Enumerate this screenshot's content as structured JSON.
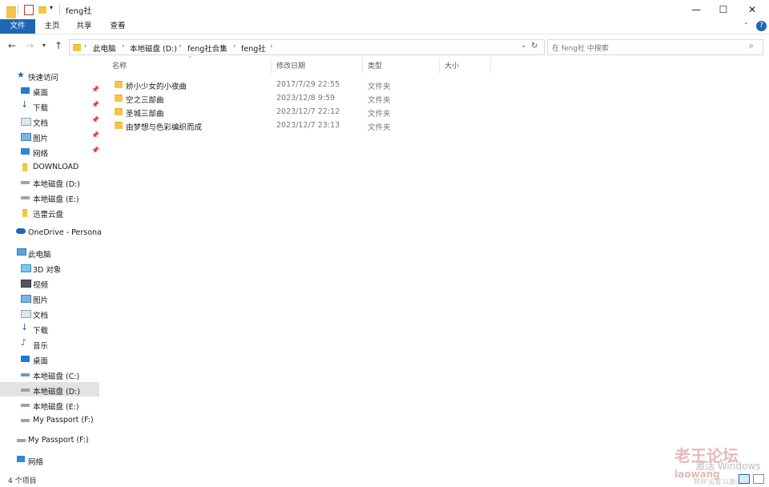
{
  "window": {
    "title": "feng社",
    "controls": {
      "minimize": "—",
      "maximize": "☐",
      "close": "✕"
    }
  },
  "ribbon": {
    "tabs": [
      "文件",
      "主页",
      "共享",
      "查看"
    ],
    "help_icon": "?"
  },
  "address": {
    "crumbs": [
      "此电脑",
      "本地磁盘 (D:)",
      "feng社合集",
      "feng社"
    ]
  },
  "search": {
    "placeholder": "在 feng社 中搜索"
  },
  "columns": {
    "name": "名称",
    "date": "修改日期",
    "type": "类型",
    "size": "大小"
  },
  "files": [
    {
      "name": "娇小少女的小夜曲",
      "date": "2017/7/29 22:55",
      "type": "文件夹"
    },
    {
      "name": "空之三部曲",
      "date": "2023/12/8 9:59",
      "type": "文件夹"
    },
    {
      "name": "圣城三部曲",
      "date": "2023/12/7 22:12",
      "type": "文件夹"
    },
    {
      "name": "由梦想与色彩编织而成",
      "date": "2023/12/7 23:13",
      "type": "文件夹"
    }
  ],
  "nav": {
    "quick_access": "快速访问",
    "quick_items": [
      "桌面",
      "下载",
      "文档",
      "图片",
      "网络",
      "DOWNLOAD",
      "本地磁盘 (D:)",
      "本地磁盘 (E:)",
      "迅雷云盘"
    ],
    "onedrive": "OneDrive - Persona",
    "this_pc": "此电脑",
    "pc_items": [
      "3D 对象",
      "视频",
      "图片",
      "文档",
      "下载",
      "音乐",
      "桌面",
      "本地磁盘 (C:)",
      "本地磁盘 (D:)",
      "本地磁盘 (E:)",
      "My Passport (F:)"
    ],
    "passport": "My Passport (F:)",
    "network": "网络"
  },
  "status": {
    "count": "4 个项目"
  },
  "watermark": {
    "text": "老王论坛",
    "sub": "laowang",
    "activate": "激活 Windows",
    "settings": "转到'设置'以激活 Windows。"
  }
}
